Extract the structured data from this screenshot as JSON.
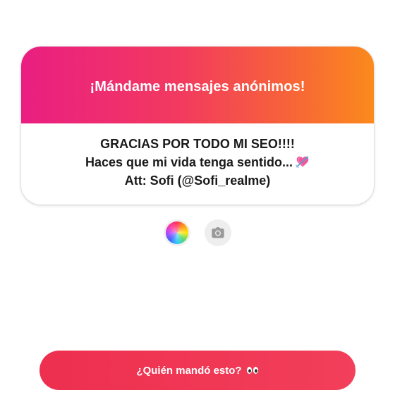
{
  "card": {
    "title": "¡Mándame mensajes anónimos!",
    "message": {
      "line1": "GRACIAS POR TODO MI SEO!!!!",
      "line2": "Haces que mi vida tenga sentido...",
      "line2_emoji": "heart-with-arrow",
      "line3": "Att: Sofi (@Sofi_realme)"
    },
    "header_gradient": [
      "#ea1e82",
      "#fb8a1c"
    ]
  },
  "controls": {
    "color_picker_icon": "color-wheel-icon",
    "camera_icon": "camera-icon"
  },
  "cta": {
    "label": "¿Quién mandó esto?",
    "emoji": "eyes",
    "color": "#f03a55"
  }
}
